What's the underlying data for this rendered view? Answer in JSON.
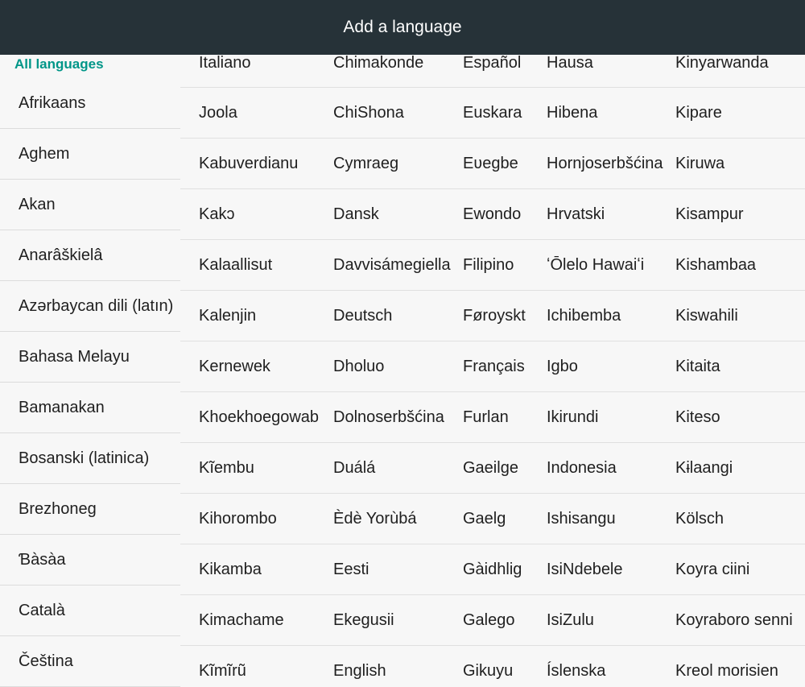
{
  "header": {
    "title": "Add a language"
  },
  "left": {
    "section_header": "All languages",
    "items": [
      "Afrikaans",
      "Aghem",
      "Akan",
      "Anarâškielâ",
      "Azərbaycan dili (latın)",
      "Bahasa Melayu",
      "Bamanakan",
      "Bosanski (latinica)",
      "Brezhoneg",
      "Ɓàsàa",
      "Català",
      "Čeština"
    ]
  },
  "grid": {
    "rows": [
      [
        "Italiano",
        "Chimakonde",
        "Español",
        "Hausa",
        "Kinyarwanda"
      ],
      [
        "Joola",
        "ChiShona",
        "Euskara",
        "Hibena",
        "Kipare"
      ],
      [
        "Kabuverdianu",
        "Cymraeg",
        "Eʋegbe",
        "Hornjoserbšćina",
        "Kiruwa"
      ],
      [
        "Kakɔ",
        "Dansk",
        "Ewondo",
        "Hrvatski",
        "Kisampur"
      ],
      [
        "Kalaallisut",
        "Davvisámegiella",
        "Filipino",
        "ʻŌlelo Hawaiʻi",
        "Kishambaa"
      ],
      [
        "Kalenjin",
        "Deutsch",
        "Føroyskt",
        "Ichibemba",
        "Kiswahili"
      ],
      [
        "Kernewek",
        "Dholuo",
        "Français",
        "Igbo",
        "Kitaita"
      ],
      [
        "Khoekhoegowab",
        "Dolnoserbšćina",
        "Furlan",
        "Ikirundi",
        "Kiteso"
      ],
      [
        "Kĩembu",
        "Duálá",
        "Gaeilge",
        "Indonesia",
        "Kɨlaangi"
      ],
      [
        "Kihorombo",
        "Èdè Yorùbá",
        "Gaelg",
        "Ishisangu",
        "Kölsch"
      ],
      [
        "Kikamba",
        "Eesti",
        "Gàidhlig",
        "IsiNdebele",
        "Koyra ciini"
      ],
      [
        "Kimachame",
        "Ekegusii",
        "Galego",
        "IsiZulu",
        "Koyraboro senni"
      ],
      [
        "Kĩmĩrũ",
        "English",
        "Gikuyu",
        "Íslenska",
        "Kreol morisien"
      ]
    ]
  }
}
